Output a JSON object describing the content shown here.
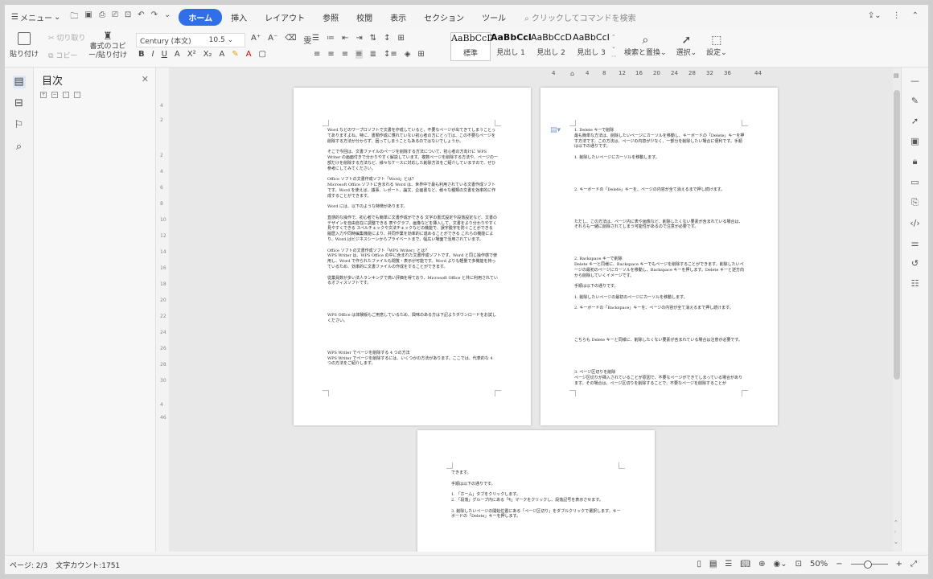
{
  "titlebar": {
    "menu_label": "メニュー",
    "tabs": [
      "ホーム",
      "挿入",
      "レイアウト",
      "参照",
      "校閲",
      "表示",
      "セクション",
      "ツール"
    ],
    "active_tab": "ホーム",
    "search_placeholder": "クリックしてコマンドを検索"
  },
  "ribbon": {
    "paste": "貼り付け",
    "cut": "切り取り",
    "copy": "コピー",
    "format_painter": "書式のコピー/貼り付け",
    "font_name": "Century (本文)",
    "font_size": "10.5",
    "styles": [
      {
        "sample": "AaBbCcD",
        "caption": "標準"
      },
      {
        "sample": "AaBbCcI",
        "caption": "見出し 1"
      },
      {
        "sample": "AaBbCcD",
        "caption": "見出し 2"
      },
      {
        "sample": "AaBbCcI",
        "caption": "見出し 3"
      }
    ],
    "search_replace": "検索と置換",
    "select": "選択",
    "settings": "設定"
  },
  "toc": {
    "title": "目次"
  },
  "ruler": {
    "h_ticks": [
      "4",
      "4",
      "8",
      "12",
      "16",
      "20",
      "24",
      "28",
      "32",
      "36",
      "44"
    ]
  },
  "page1": {
    "paragraphs": [
      "Word などのワープロソフトで文書を作成していると、不要なページが出てきてしまうことってありますよね。特に、書類作成に慣れていない初心者の方にとっては、この不要なページを削除する方法が分からず、困ってしまうこともあるのではないでしょうか。",
      "そこで今回は、文書ファイルのページを削除する方法について、初心者の方向けに WPS Writer の画面付きで分かりやすく解説しています。複数ページを削除する方法や、ページの一部だけを削除する方法など、様々なケースに対応した削除方法をご紹介していますので、ぜひ参考にしてみてください。",
      "Office ソフトの文書作成ソフト「Word」とは？\nMicrosoft Office ソフトに含まれる Word は、世界中で最も利用されている文書作成ソフトです。Word を使えば、議事、レポート、論文、企画書など、様々な種類の文書を効率的に作成することができます。",
      "Word には、以下のような特徴があります。",
      "直感的な操作で、初心者でも簡単に文書作成ができる 文字の書式設定や段落設定など、文書のデザインを自由自在に調整できる 表やグラフ、画像などを挿入して、文書をより分かりやすく見やすくできる スペルチェックや文法チェックなどの機能で、誤字脱字を防ぐことができる 履歴入力や同時編集機能により、共同作業を効率的に進めることができる これらの機能により、Word はビジネスシーンからプライベートまで、幅広い場面で活用されています。",
      "Office ソフトの文書作成ソフト「WPS Writer」とは？\nWPS Writer は、WPS Office の中に含まれた文書作成ソフトです。Word と同じ操作感で使用し、Word で作られたファイルも閲覧・表示が可能です。Word よりも軽量で多機能を持っているため、効率的に文書ファイルの作成をすることができます。",
      "従業員数が多い法人ランキングで高い評価を得ており、Microsoft Office と共に利用されているオフィスソフトです。",
      "WPS Office は体験版もご用意しているため、興味のある方は下記よりダウンロードをお試しください。",
      "WPS Writer でページを削除する 4 つの方法\nWPS Writer でページを削除するには、いくつかの方法があります。ここでは、代表的な 4 つの方法をご紹介します。"
    ]
  },
  "page2": {
    "paragraphs": [
      "1. Delete キーで削除\n最も簡単な方法は、削除したいページにカーソルを移動し、キーボードの「Delete」キーを押す方法です。この方法は、ページの内容が少なく、一部分を削除したい場合に便利です。手順は以下の通りです。",
      "1. 削除したいページにカーソルを移動します。",
      "2. キーボードの「Delete」キーを、ページの内容が全て消えるまで押し続けます。",
      "ただし、この方法は、ページ内に表や画像など、削除したくない要素が含まれている場合は、それらも一緒に削除されてしまう可能性があるので注意が必要です。",
      "2. Backspace キーで削除\nDelete キーと同様に、Backspace キーでもページを削除することができます。削除したいページの最初のページにカーソルを移動し、Backspace キーを押します。Delete キーと逆方向から削除していくイメージです。",
      "手順は以下の通りです。",
      "1. 削除したいページの最初のページにカーソルを移動します。",
      "2. キーボードの「Backspace」キーを、ページの内容が全て消えるまで押し続けます。",
      "こちらも Delete キーと同様に、削除したくない要素が含まれている場合は注意が必要です。",
      "3. ページ区切りを削除\nページ区切りが挿入されていることが原因で、不要なページができてしまっている場合があります。その場合は、ページ区切りを削除することで、不要なページを削除することが"
    ]
  },
  "page3": {
    "paragraphs": [
      "できます。",
      "手順は以下の通りです。",
      "1. 「ホーム」タブをクリックします。\n2. 「段落」グループ内にある「¶」マークをクリックし、段落記号を表示させます。",
      "3. 削除したいページの開始位置にある「ページ区切り」をダブルクリックで選択します。キーボードの「Delete」キーを押します。"
    ]
  },
  "status": {
    "page": "ページ: 2/3",
    "wordcount": "文字カウント:1751",
    "zoom": "50%"
  }
}
